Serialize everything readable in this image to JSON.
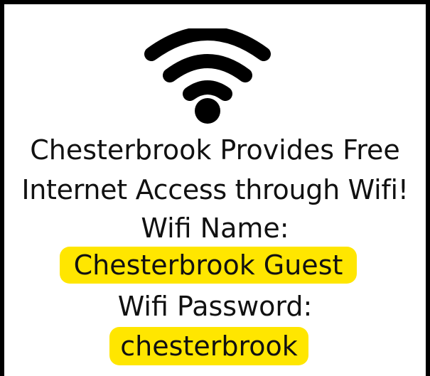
{
  "colors": {
    "border": "#000000",
    "highlight": "#ffe600",
    "text": "#111111",
    "icon": "#000000"
  },
  "icon": "wifi-icon",
  "sign": {
    "line1": "Chesterbrook Provides Free",
    "line2": "Internet Access through Wifi!",
    "name_label": "Wifi Name:",
    "name_value": "Chesterbrook Guest",
    "password_label": "Wifi Password:",
    "password_value": "chesterbrook"
  }
}
